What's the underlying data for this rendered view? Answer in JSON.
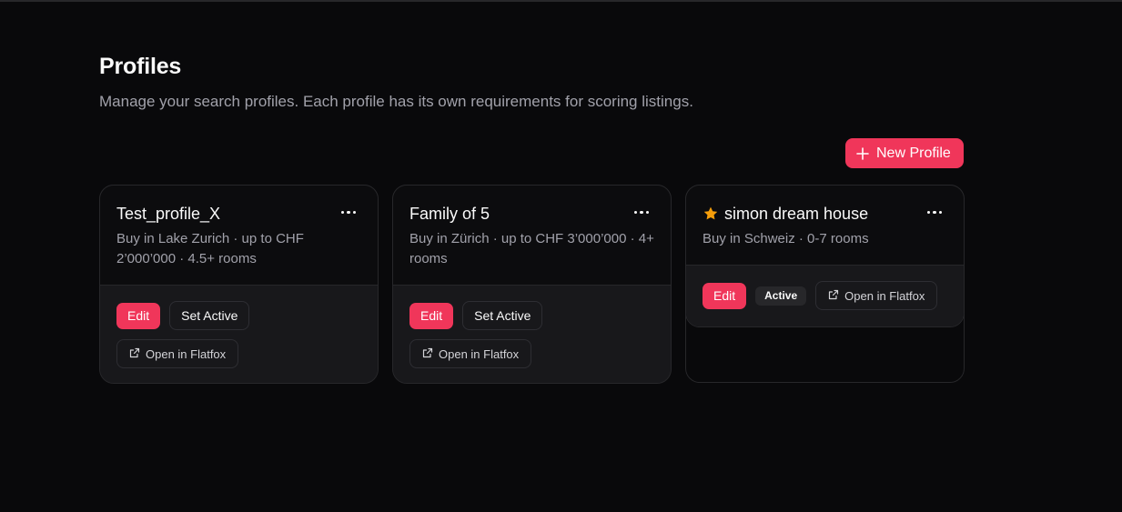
{
  "page": {
    "title": "Profiles",
    "subtitle": "Manage your search profiles. Each profile has its own requirements for scoring listings."
  },
  "toolbar": {
    "new_profile_label": "New Profile",
    "new_profile_icon": "plus-icon"
  },
  "colors": {
    "accent": "#f0365a",
    "background": "#09090b",
    "card_footer": "#18181b",
    "star": "#f59e0b"
  },
  "profiles": [
    {
      "name": "Test_profile_X",
      "meta": "Buy in Lake Zurich · up to CHF 2’000’000 · 4.5+ rooms",
      "is_active": false,
      "edit_label": "Edit",
      "set_active_label": "Set Active",
      "open_label": "Open in Flatfox",
      "menu_icon": "more-horizontal-icon"
    },
    {
      "name": "Family of 5",
      "meta": "Buy in Zürich · up to CHF 3’000’000 · 4+ rooms",
      "is_active": false,
      "edit_label": "Edit",
      "set_active_label": "Set Active",
      "open_label": "Open in Flatfox",
      "menu_icon": "more-horizontal-icon"
    },
    {
      "name": "simon dream house",
      "meta": "Buy in Schweiz · 0-7 rooms",
      "is_active": true,
      "active_badge": "Active",
      "edit_label": "Edit",
      "open_label": "Open in Flatfox",
      "menu_icon": "more-horizontal-icon",
      "status_icon": "star-icon"
    }
  ]
}
